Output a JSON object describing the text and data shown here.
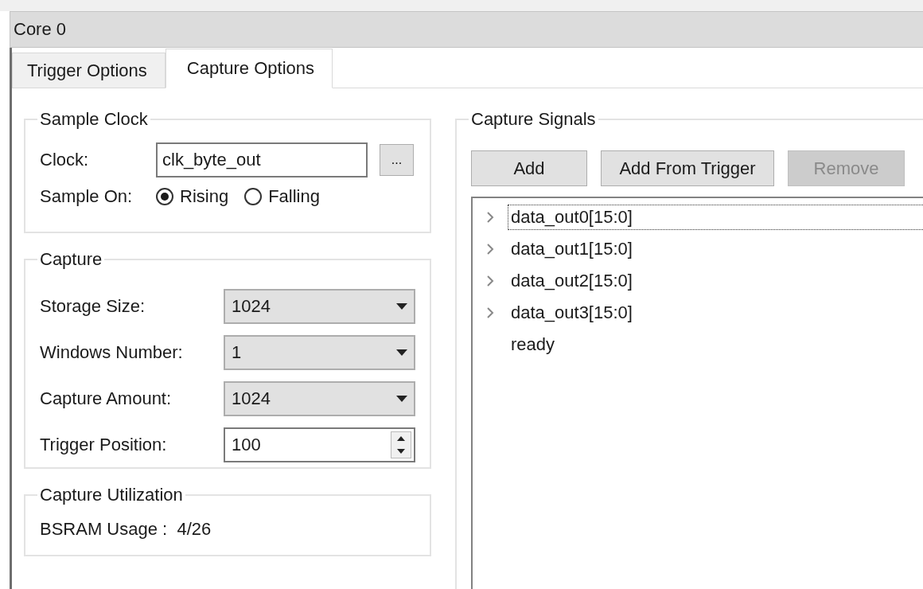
{
  "window": {
    "title": "Core 0"
  },
  "tabs": [
    {
      "label": "Trigger Options",
      "selected": false
    },
    {
      "label": "Capture Options",
      "selected": true
    }
  ],
  "sample_clock": {
    "title": "Sample Clock",
    "clock_label": "Clock:",
    "clock_value": "clk_byte_out",
    "browse_button": "...",
    "sample_on_label": "Sample On:",
    "edges": [
      {
        "label": "Rising",
        "selected": true
      },
      {
        "label": "Falling",
        "selected": false
      }
    ]
  },
  "capture": {
    "title": "Capture",
    "fields": [
      {
        "kind": "dropdown",
        "label": "Storage Size:",
        "value": "1024"
      },
      {
        "kind": "dropdown",
        "label": "Windows Number:",
        "value": "1"
      },
      {
        "kind": "dropdown",
        "label": "Capture Amount:",
        "value": "1024"
      },
      {
        "kind": "spinbox",
        "label": "Trigger Position:",
        "value": "100"
      }
    ]
  },
  "utilization": {
    "title": "Capture Utilization",
    "text": "BSRAM Usage :  4/26"
  },
  "capture_signals": {
    "title": "Capture Signals",
    "buttons": [
      {
        "label": "Add",
        "disabled": false
      },
      {
        "label": "Add From Trigger",
        "disabled": false
      },
      {
        "label": "Remove",
        "disabled": true
      }
    ],
    "signals": [
      {
        "name": "data_out0[15:0]",
        "expandable": true,
        "focused": true
      },
      {
        "name": "data_out1[15:0]",
        "expandable": true,
        "focused": false
      },
      {
        "name": "data_out2[15:0]",
        "expandable": true,
        "focused": false
      },
      {
        "name": "data_out3[15:0]",
        "expandable": true,
        "focused": false
      },
      {
        "name": "ready",
        "expandable": false,
        "focused": false
      }
    ]
  }
}
